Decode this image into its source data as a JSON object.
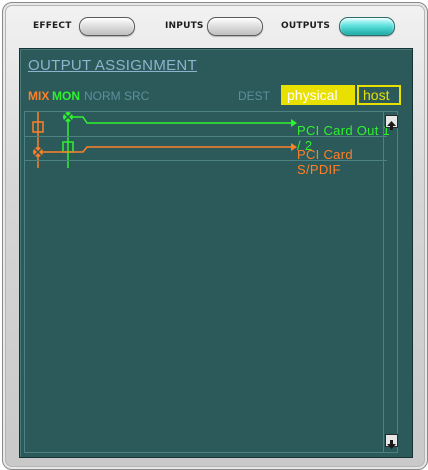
{
  "tabs": [
    {
      "label": "EFFECT",
      "active": false
    },
    {
      "label": "INPUTS",
      "active": false
    },
    {
      "label": "OUTPUTS",
      "active": true
    }
  ],
  "panel": {
    "title": "OUTPUT ASSIGNMENT",
    "columns": {
      "mix": "MIX",
      "mon": "MON",
      "norm_src": "NORM SRC",
      "dest": "DEST"
    },
    "dest_buttons": {
      "physical": "physical",
      "host": "host",
      "selected": "physical"
    },
    "routes": [
      {
        "label": "PCI Card Out 1 / 2",
        "color": "#2ef22e"
      },
      {
        "label": "PCI Card S/PDIF",
        "color": "#ff7f27"
      }
    ]
  },
  "colors": {
    "mix": "#ff7f27",
    "mon": "#2ef22e",
    "panel_bg": "#2c5a5a",
    "dest_highlight": "#e9e000"
  },
  "icons": {
    "scroll_up": "arrow-up-icon",
    "scroll_down": "arrow-down-icon"
  }
}
